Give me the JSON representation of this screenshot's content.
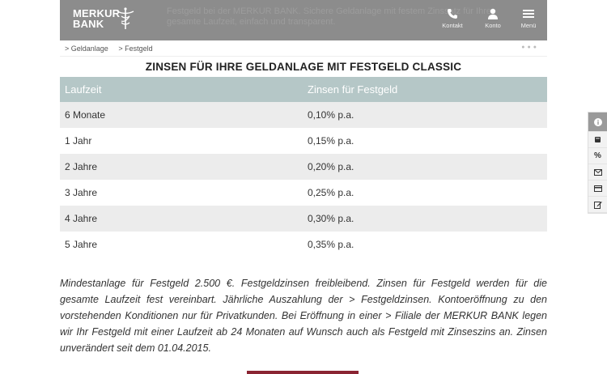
{
  "header": {
    "logo_line1": "MERKUR",
    "logo_line2": "BANK",
    "ghost_text": "Festgeld bei der MERKUR BANK. Sichere Geldanlage mit festem Zinssatz für Ihre gesamte Laufzeit, einfach und transparent.",
    "kontakt_label": "Kontakt",
    "konto_label": "Konto",
    "menu_label": "Menü"
  },
  "breadcrumb": {
    "item1": "> Geldanlage",
    "item2": "> Festgeld"
  },
  "title": "ZINSEN FÜR IHRE GELDANLAGE MIT FESTGELD CLASSIC",
  "table": {
    "headers": [
      "Laufzeit",
      "Zinsen für Festgeld"
    ],
    "rows": [
      [
        "6 Monate",
        "0,10% p.a."
      ],
      [
        "1 Jahr",
        "0,15% p.a."
      ],
      [
        "2 Jahre",
        "0,20% p.a."
      ],
      [
        "3 Jahre",
        "0,25% p.a."
      ],
      [
        "4 Jahre",
        "0,30% p.a."
      ],
      [
        "5 Jahre",
        "0,35% p.a."
      ]
    ]
  },
  "note": "Mindestanlage für Festgeld 2.500 €. Festgeldzinsen freibleibend. Zinsen für Festgeld werden für die gesamte Laufzeit fest vereinbart. Jährliche Auszahlung der > Festgeldzinsen. Kontoeröffnung zu den vorstehenden Konditionen nur für Privatkunden. Bei Eröffnung in einer > Filiale der MERKUR BANK legen wir Ihr Festgeld mit einer Laufzeit ab 24 Monaten auf Wunsch auch als Festgeld mit Zinseszins an. Zinsen unverändert seit dem 01.04.2015.",
  "colors": {
    "header_bg": "#8c8c8c",
    "table_header_bg": "#b5c7c7",
    "row_alt_bg": "#ececec",
    "accent": "#8a2432"
  },
  "icons": {
    "sidebar": [
      "info-icon",
      "book-icon",
      "percent-icon",
      "mail-icon",
      "card-icon",
      "edit-icon"
    ]
  }
}
